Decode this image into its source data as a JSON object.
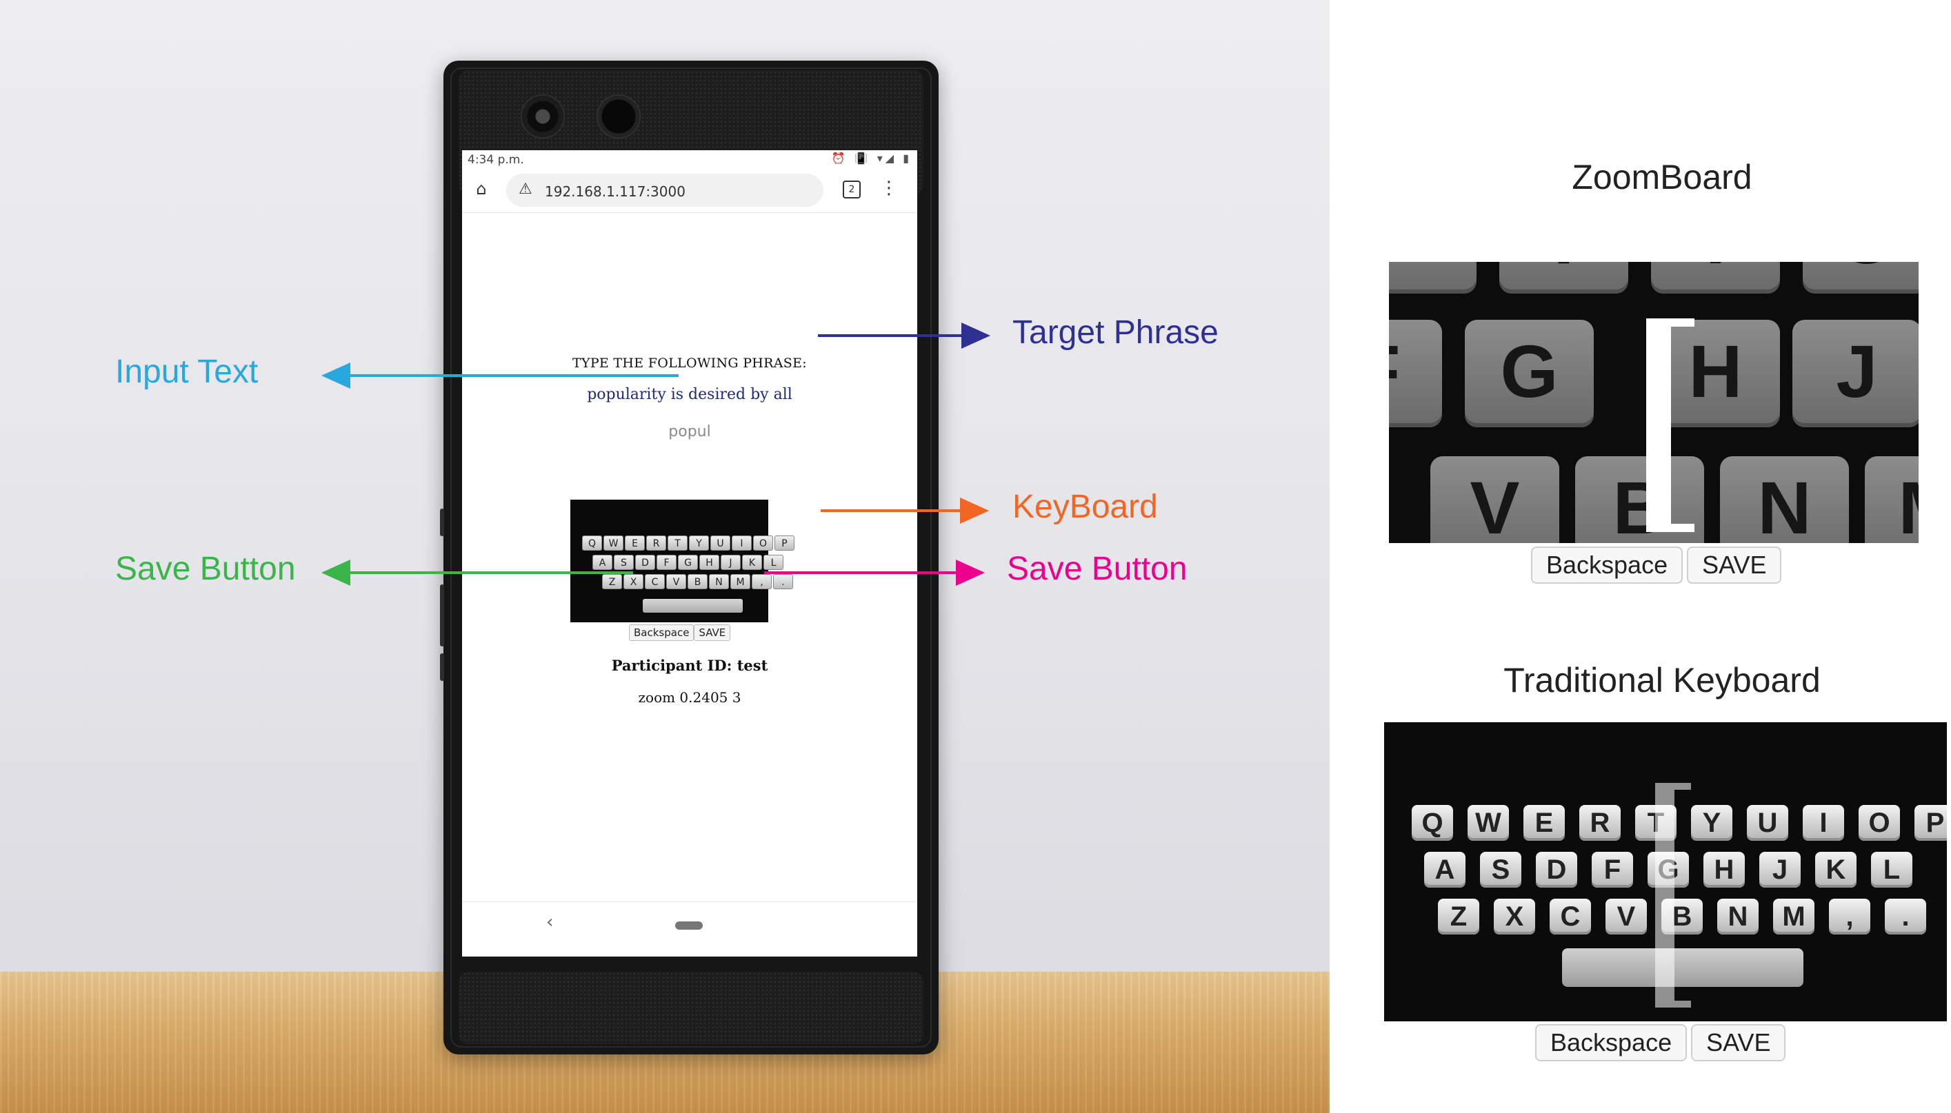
{
  "colors": {
    "target_phrase": "#2e3192",
    "input_text": "#29a8e0",
    "keyboard": "#f26522",
    "save_button_left": "#39b54a",
    "save_button_right": "#ec008c"
  },
  "phone": {
    "status_time": "4:34 p.m.",
    "status_icons": "⏰ 📳 ▾◢ ▮",
    "url": "192.168.1.117:3000",
    "tab_count": "2",
    "instruction_heading": "TYPE THE FOLLOWING PHRASE:",
    "target_phrase": "popularity is desired by all",
    "typed_text": "popul",
    "keyboard_rows": [
      [
        "Q",
        "W",
        "E",
        "R",
        "T",
        "Y",
        "U",
        "I",
        "O",
        "P"
      ],
      [
        "A",
        "S",
        "D",
        "F",
        "G",
        "H",
        "J",
        "K",
        "L"
      ],
      [
        "Z",
        "X",
        "C",
        "V",
        "B",
        "N",
        "M",
        ",",
        "."
      ]
    ],
    "backspace_label": "Backspace",
    "save_label": "SAVE",
    "participant_line": "Participant ID: test",
    "zoom_line": "zoom 0.2405 3"
  },
  "annotations": {
    "target_phrase": "Target Phrase",
    "input_text": "Input Text",
    "keyboard": "KeyBoard",
    "save_button_left": "Save Button",
    "save_button_right": "Save Button"
  },
  "zoomboard": {
    "title": "ZoomBoard",
    "top_keys": [
      "T",
      "Y",
      "U"
    ],
    "mid_keys": [
      "F",
      "G",
      "H",
      "J"
    ],
    "bot_keys": [
      "V",
      "B",
      "N",
      "M"
    ],
    "backspace_label": "Backspace",
    "save_label": "SAVE"
  },
  "traditional": {
    "title": "Traditional Keyboard",
    "rows": [
      [
        "Q",
        "W",
        "E",
        "R",
        "T",
        "Y",
        "U",
        "I",
        "O",
        "P"
      ],
      [
        "A",
        "S",
        "D",
        "F",
        "G",
        "H",
        "J",
        "K",
        "L"
      ],
      [
        "Z",
        "X",
        "C",
        "V",
        "B",
        "N",
        "M",
        ",",
        "."
      ]
    ],
    "backspace_label": "Backspace",
    "save_label": "SAVE"
  }
}
